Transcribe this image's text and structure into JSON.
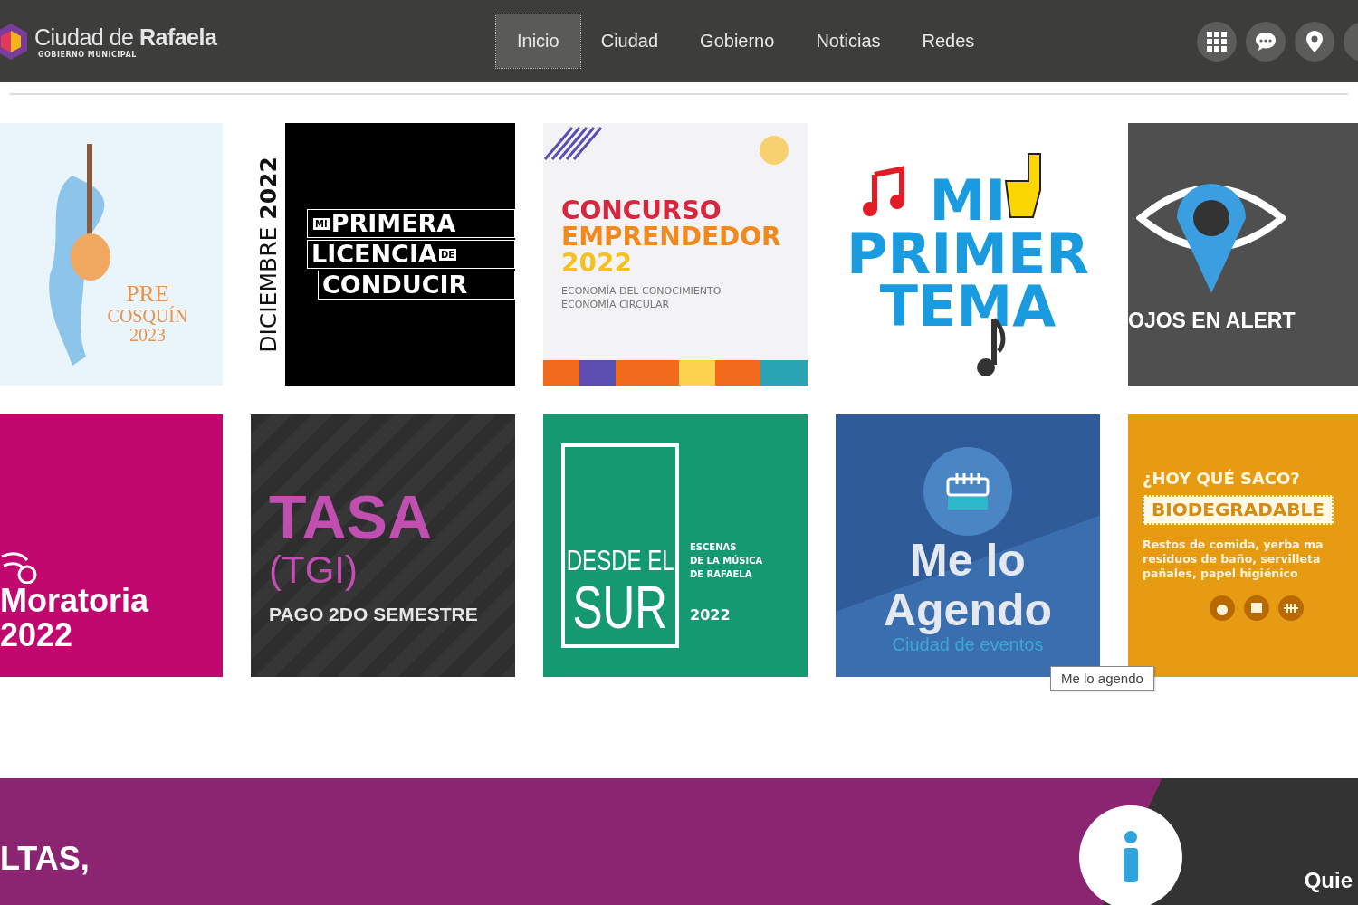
{
  "header": {
    "logo": {
      "title": "Ciudad de **Rafaela**",
      "subtitle": "GOBIERNO MUNICIPAL"
    },
    "nav": [
      {
        "label": "Inicio",
        "selected": true
      },
      {
        "label": "Ciudad",
        "selected": false
      },
      {
        "label": "Gobierno",
        "selected": false
      },
      {
        "label": "Noticias",
        "selected": false
      },
      {
        "label": "Redes",
        "selected": false
      }
    ]
  },
  "tiles": [
    {
      "kind": "precosquin",
      "lines": [
        "PRE",
        "COSQUÍN",
        "2023"
      ]
    },
    {
      "kind": "licencia",
      "side": "DICIEMBRE **2022**",
      "lines": [
        "PRIMERA",
        "LICENCIA",
        "CONDUCIR"
      ],
      "tags": [
        "MI",
        "DE"
      ]
    },
    {
      "kind": "concurso",
      "lines": [
        "CONCURSO",
        "EMPRENDEDOR",
        "2022"
      ],
      "notes": [
        "ECONOMÍA DEL CONOCIMIENTO",
        "ECONOMÍA CIRCULAR"
      ]
    },
    {
      "kind": "tema",
      "lines": [
        "MI",
        "PRIMER",
        "TEMA"
      ]
    },
    {
      "kind": "ojos",
      "lines": [
        "OJOS EN ALERT"
      ]
    },
    {
      "kind": "moratoria",
      "lines": [
        "Moratoria",
        "2022"
      ]
    },
    {
      "kind": "tasa",
      "lines": [
        "TASA",
        "(TGI)",
        "PAGO 2DO SEMESTRE"
      ]
    },
    {
      "kind": "sur",
      "lines": [
        "DESDE EL",
        "SUR"
      ],
      "notes": [
        "ESCENAS",
        "DE LA MÚSICA",
        "DE RAFAELA"
      ],
      "year": "2022"
    },
    {
      "kind": "agendo",
      "lines": [
        "Me lo",
        "Agendo"
      ],
      "notes": [
        "Ciudad de eventos"
      ]
    },
    {
      "kind": "saco",
      "lines": [
        "¿HOY QUÉ SACO?",
        "BIODEGRADABLE"
      ],
      "notes": [
        "Restos de comida, yerba ma",
        "residuos de baño, servilleta",
        "pañales, papel higiénico"
      ]
    }
  ],
  "tooltip": "Me lo agendo",
  "banner": {
    "left_text": "LTAS,",
    "right_text": "Quie"
  }
}
